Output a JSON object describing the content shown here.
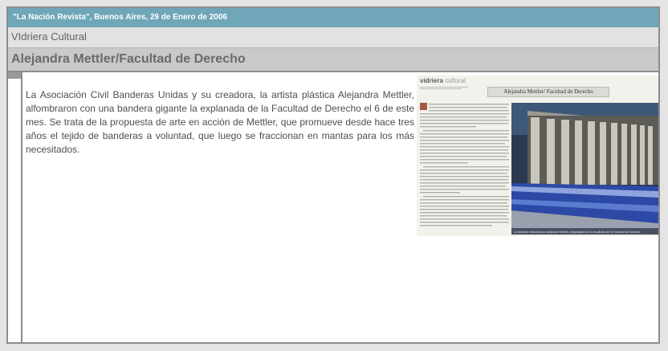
{
  "header": {
    "source_date": "\"La Nación Revista\",  Buenos Aires, 29 de Enero de 2006"
  },
  "section": {
    "title": "VIdriera Cultural"
  },
  "article": {
    "title": "Alejandra Mettler/Facultad de Derecho",
    "body": "La Asociación Civil Banderas Unidas y su creadora, la artista plástica Alejandra Mettler, alfombraron con una bandera gigante la explanada de la Facultad de Derecho el 6 de este mes. Se trata de la propuesta de arte en acción de Mettler, que promueve desde hace tres años el tejido de banderas a voluntad, que luego se fraccionan en mantas para los más necesitados."
  },
  "clipping": {
    "brand_left": "vidriera",
    "brand_right": "cultural",
    "headline": "Alejandra Mettler/ Facultad de Derecho",
    "caption": "La bandera realizada por Alejandra Mettler, desplegada en la escalinata de la Facultad de Derecho"
  }
}
